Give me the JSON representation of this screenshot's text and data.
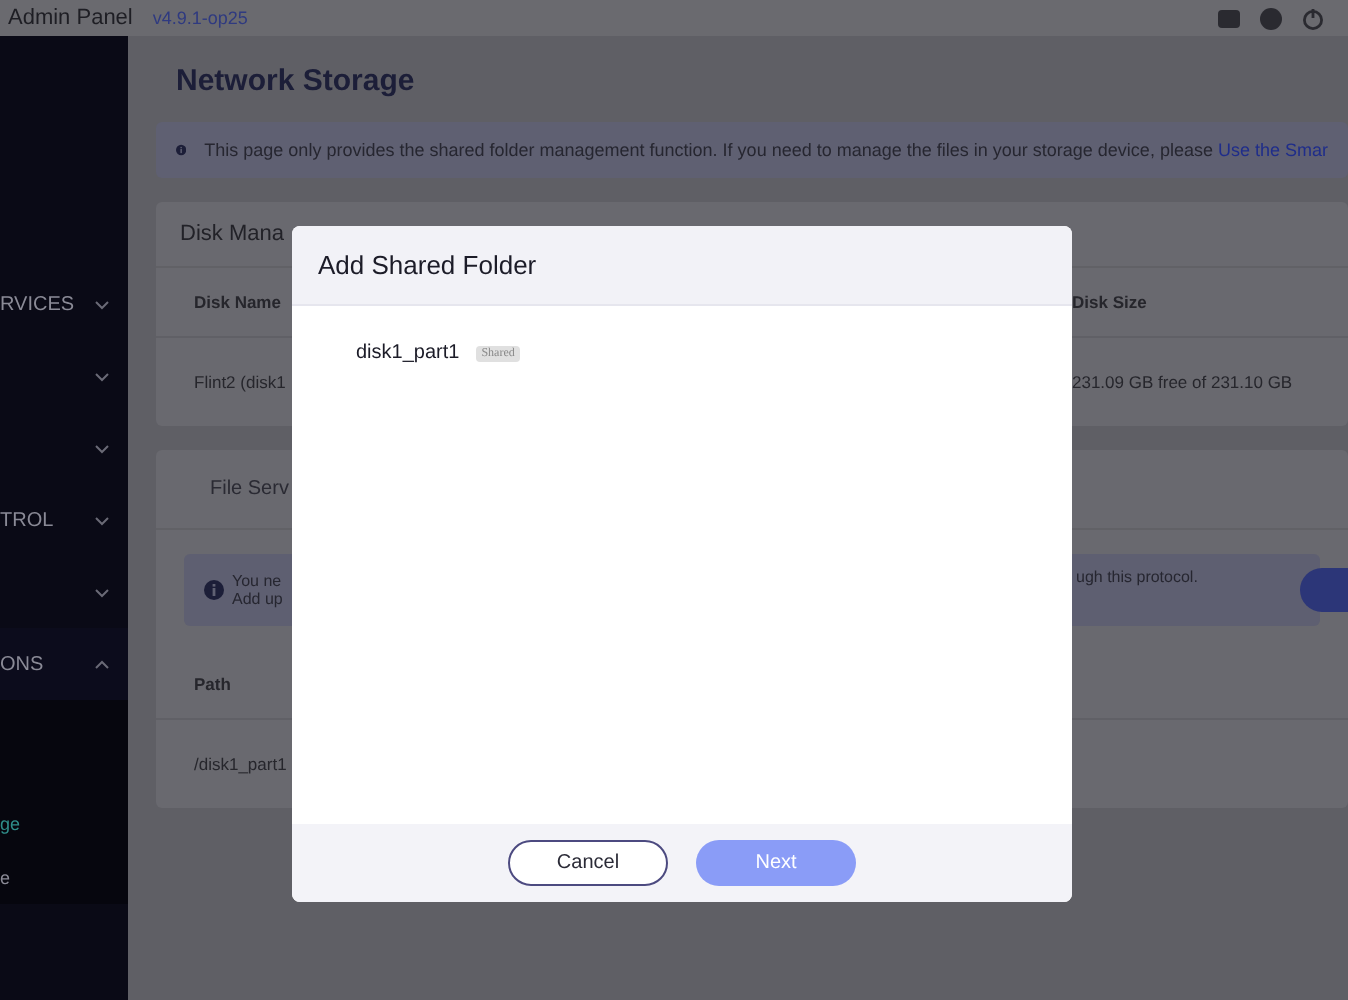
{
  "top_bar": {
    "title": "Admin Panel",
    "version": "v4.9.1-op25"
  },
  "sidebar": {
    "items": [
      {
        "label": "RVICES",
        "expanded": false
      },
      {
        "expanded": false
      },
      {
        "expanded": false
      },
      {
        "label": "TROL",
        "expanded": false
      },
      {
        "expanded": false
      },
      {
        "label": "ONS",
        "expanded": true,
        "children": [
          {
            "label": "ge",
            "selected": true
          },
          {
            "label": "e",
            "selected": false
          }
        ]
      }
    ]
  },
  "page": {
    "title": "Network Storage",
    "notice": {
      "text": "This page only provides the shared folder management function. If you need to manage the files in your storage device, please ",
      "link": "Use the Smar"
    },
    "disk_card": {
      "title": "Disk Mana",
      "columns": [
        "Disk Name",
        "Disk Size"
      ],
      "rows": [
        [
          "Flint2 (disk1",
          "231.09 GB free of 231.10 GB"
        ]
      ]
    },
    "file_card": {
      "tab": "File Serv",
      "notice_left": [
        "You ne",
        "Add up"
      ],
      "notice_right": "ugh this protocol.",
      "columns": [
        "Path"
      ],
      "rows": [
        [
          "/disk1_part1"
        ]
      ]
    }
  },
  "dialog": {
    "title": "Add Shared Folder",
    "folders": [
      {
        "name": "disk1_part1",
        "badge": "Shared"
      }
    ],
    "buttons": [
      {
        "label": "Cancel",
        "kind": "secondary"
      },
      {
        "label": "Next",
        "kind": "primary"
      }
    ]
  }
}
